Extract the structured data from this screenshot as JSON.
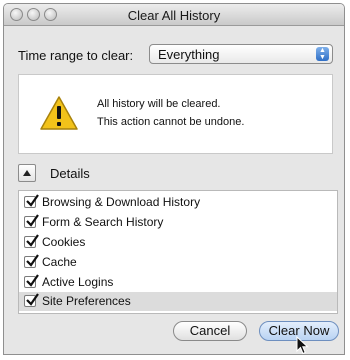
{
  "window": {
    "title": "Clear All History"
  },
  "time_range": {
    "label": "Time range to clear:",
    "selected": "Everything"
  },
  "warning": {
    "icon": "warning-triangle-icon",
    "line1": "All history will be cleared.",
    "line2": "This action cannot be undone."
  },
  "details": {
    "label": "Details",
    "items": [
      {
        "label": "Browsing & Download History",
        "checked": true
      },
      {
        "label": "Form & Search History",
        "checked": true
      },
      {
        "label": "Cookies",
        "checked": true
      },
      {
        "label": "Cache",
        "checked": true
      },
      {
        "label": "Active Logins",
        "checked": true
      },
      {
        "label": "Site Preferences",
        "checked": true
      }
    ]
  },
  "buttons": {
    "cancel": "Cancel",
    "clear_now": "Clear Now"
  },
  "colors": {
    "primary_button": "#b9d3f3",
    "warning_yellow": "#f2c21a",
    "selected_row": "#dcdcdc"
  }
}
